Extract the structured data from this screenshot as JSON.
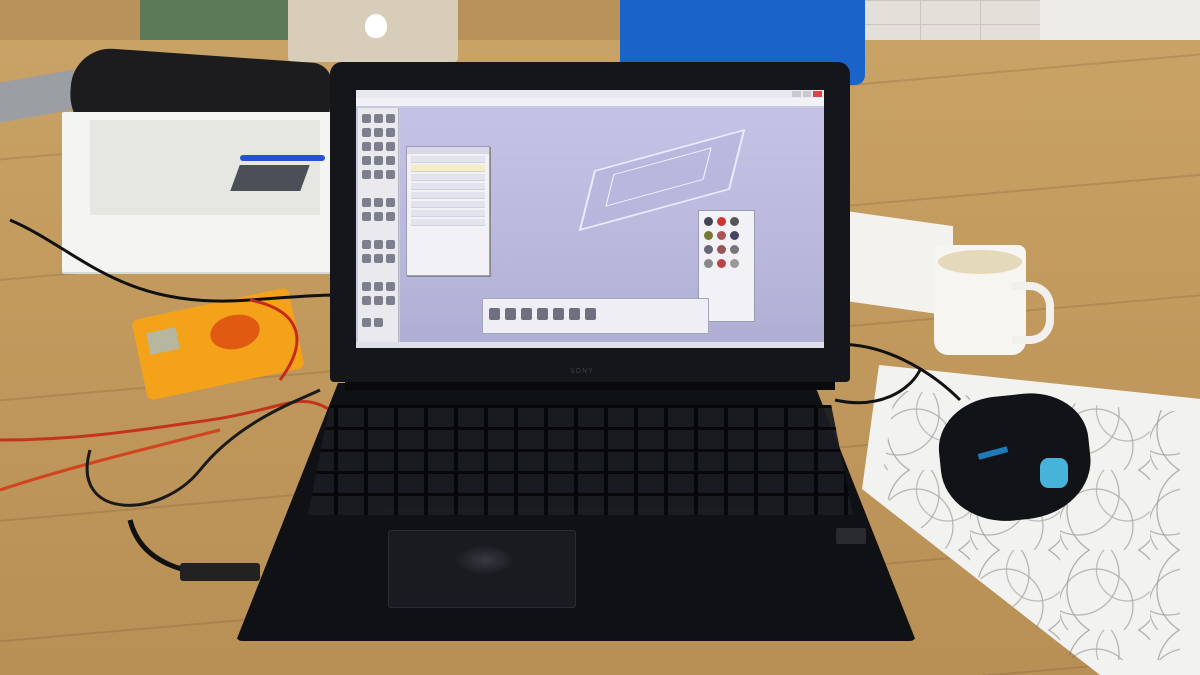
{
  "scene": {
    "description_tags": [
      "laptop",
      "3d-modeling-software",
      "gaming-mouse",
      "multimeter",
      "coffee-mug",
      "paper-with-scribbles",
      "wooden-table"
    ]
  },
  "laptop": {
    "brand": "SONY",
    "screen": {
      "title_text": "",
      "menu_items": [],
      "layers_panel_title": "",
      "status_text": ""
    }
  },
  "colors": {
    "table": "#c29a5e",
    "viewport": "#c4c3e6",
    "mouse_glow": "#4cc6f0",
    "multimeter": "#f3a21a",
    "shirt": "#1a63c9"
  }
}
